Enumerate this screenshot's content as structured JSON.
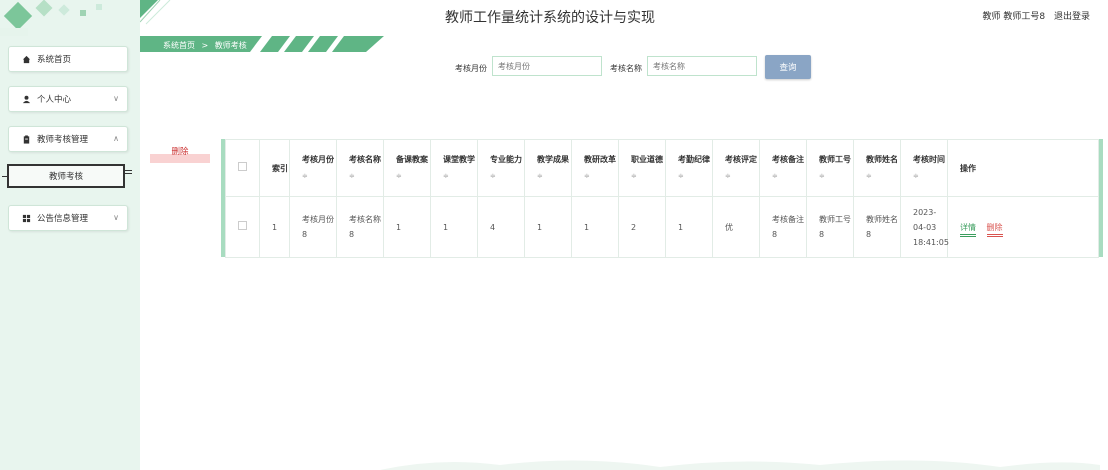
{
  "header": {
    "title": "教师工作量统计系统的设计与实现",
    "user": "教师 教师工号8",
    "logout": "退出登录"
  },
  "breadcrumb": {
    "home": "系统首页",
    "separator": ">",
    "current": "教师考核"
  },
  "sidebar": {
    "items": [
      {
        "label": "系统首页",
        "icon": "home-icon"
      },
      {
        "label": "个人中心",
        "icon": "user-icon"
      },
      {
        "label": "教师考核管理",
        "icon": "clipboard-icon"
      },
      {
        "label": "公告信息管理",
        "icon": "grid-icon"
      }
    ],
    "submenu": {
      "label": "教师考核"
    }
  },
  "search": {
    "month_label": "考核月份",
    "month_placeholder": "考核月份",
    "name_label": "考核名称",
    "name_placeholder": "考核名称",
    "button": "查询"
  },
  "batch_delete": "删除",
  "table": {
    "headers": [
      "索引",
      "考核月份",
      "考核名称",
      "备课教案",
      "课堂教学",
      "专业能力",
      "教学成果",
      "教研改革",
      "职业道德",
      "考勤纪律",
      "考核评定",
      "考核备注",
      "教师工号",
      "教师姓名",
      "考核时间",
      "操作"
    ],
    "rows": [
      {
        "index": "1",
        "month": "考核月份8",
        "name": "考核名称8",
        "prep": "1",
        "class": "1",
        "ability": "4",
        "result": "1",
        "reform": "1",
        "ethics": "2",
        "attendance": "1",
        "grade": "优",
        "remark": "考核备注8",
        "teacher_no": "教师工号8",
        "teacher_name": "教师姓名8",
        "time": "2023-04-03 18:41:05",
        "detail": "详情",
        "delete": "删除"
      }
    ]
  },
  "colors": {
    "accent": "#3a9d5d",
    "sidebar_bg": "#e8f5ee",
    "button": "#8aa5c5",
    "danger": "#d9534f"
  }
}
